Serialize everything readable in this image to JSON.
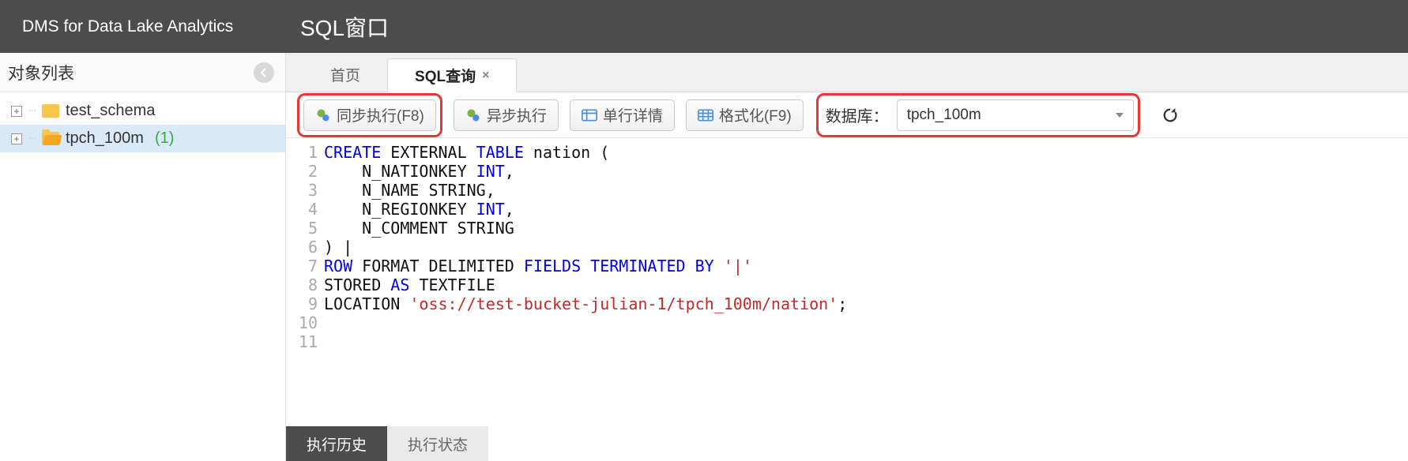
{
  "header": {
    "brand": "DMS for Data Lake Analytics",
    "title": "SQL窗口"
  },
  "sidebar": {
    "title": "对象列表",
    "items": [
      {
        "label": "test_schema",
        "count": null,
        "selected": false
      },
      {
        "label": "tpch_100m",
        "count": "(1)",
        "selected": true
      }
    ]
  },
  "tabs": [
    {
      "label": "首页",
      "active": false,
      "closable": false
    },
    {
      "label": "SQL查询",
      "active": true,
      "closable": true
    }
  ],
  "toolbar": {
    "sync_exec": "同步执行(F8)",
    "async_exec": "异步执行",
    "row_detail": "单行详情",
    "format": "格式化(F9)",
    "db_label": "数据库：",
    "db_value": "tpch_100m"
  },
  "editor": {
    "lines": [
      {
        "n": 1,
        "tokens": [
          {
            "t": "CREATE",
            "c": "kw-blue"
          },
          {
            "t": " EXTERNAL ",
            "c": ""
          },
          {
            "t": "TABLE",
            "c": "kw-blue"
          },
          {
            "t": " nation (",
            "c": ""
          }
        ]
      },
      {
        "n": 2,
        "tokens": [
          {
            "t": "    N_NATIONKEY ",
            "c": ""
          },
          {
            "t": "INT",
            "c": "kw-blue"
          },
          {
            "t": ",",
            "c": ""
          }
        ]
      },
      {
        "n": 3,
        "tokens": [
          {
            "t": "    N_NAME STRING,",
            "c": ""
          }
        ]
      },
      {
        "n": 4,
        "tokens": [
          {
            "t": "    N_REGIONKEY ",
            "c": ""
          },
          {
            "t": "INT",
            "c": "kw-blue"
          },
          {
            "t": ",",
            "c": ""
          }
        ]
      },
      {
        "n": 5,
        "tokens": [
          {
            "t": "    N_COMMENT STRING",
            "c": ""
          }
        ]
      },
      {
        "n": 6,
        "tokens": [
          {
            "t": ") ",
            "c": ""
          },
          {
            "t": "|",
            "c": "cursor-pipe"
          }
        ]
      },
      {
        "n": 7,
        "tokens": [
          {
            "t": "ROW",
            "c": "kw-blue"
          },
          {
            "t": " FORMAT DELIMITED ",
            "c": ""
          },
          {
            "t": "FIELDS",
            "c": "kw-blue"
          },
          {
            "t": " ",
            "c": ""
          },
          {
            "t": "TERMINATED",
            "c": "kw-blue"
          },
          {
            "t": " ",
            "c": ""
          },
          {
            "t": "BY",
            "c": "kw-blue"
          },
          {
            "t": " ",
            "c": ""
          },
          {
            "t": "'|'",
            "c": "kw-red"
          }
        ]
      },
      {
        "n": 8,
        "tokens": [
          {
            "t": "STORED ",
            "c": ""
          },
          {
            "t": "AS",
            "c": "kw-blue"
          },
          {
            "t": " TEXTFILE",
            "c": ""
          }
        ]
      },
      {
        "n": 9,
        "tokens": [
          {
            "t": "LOCATION ",
            "c": ""
          },
          {
            "t": "'oss://test-bucket-julian-1/tpch_100m/nation'",
            "c": "kw-red"
          },
          {
            "t": ";",
            "c": ""
          }
        ]
      },
      {
        "n": 10,
        "tokens": []
      },
      {
        "n": 11,
        "tokens": []
      }
    ]
  },
  "bottom_tabs": [
    {
      "label": "执行历史",
      "active": true
    },
    {
      "label": "执行状态",
      "active": false
    }
  ]
}
